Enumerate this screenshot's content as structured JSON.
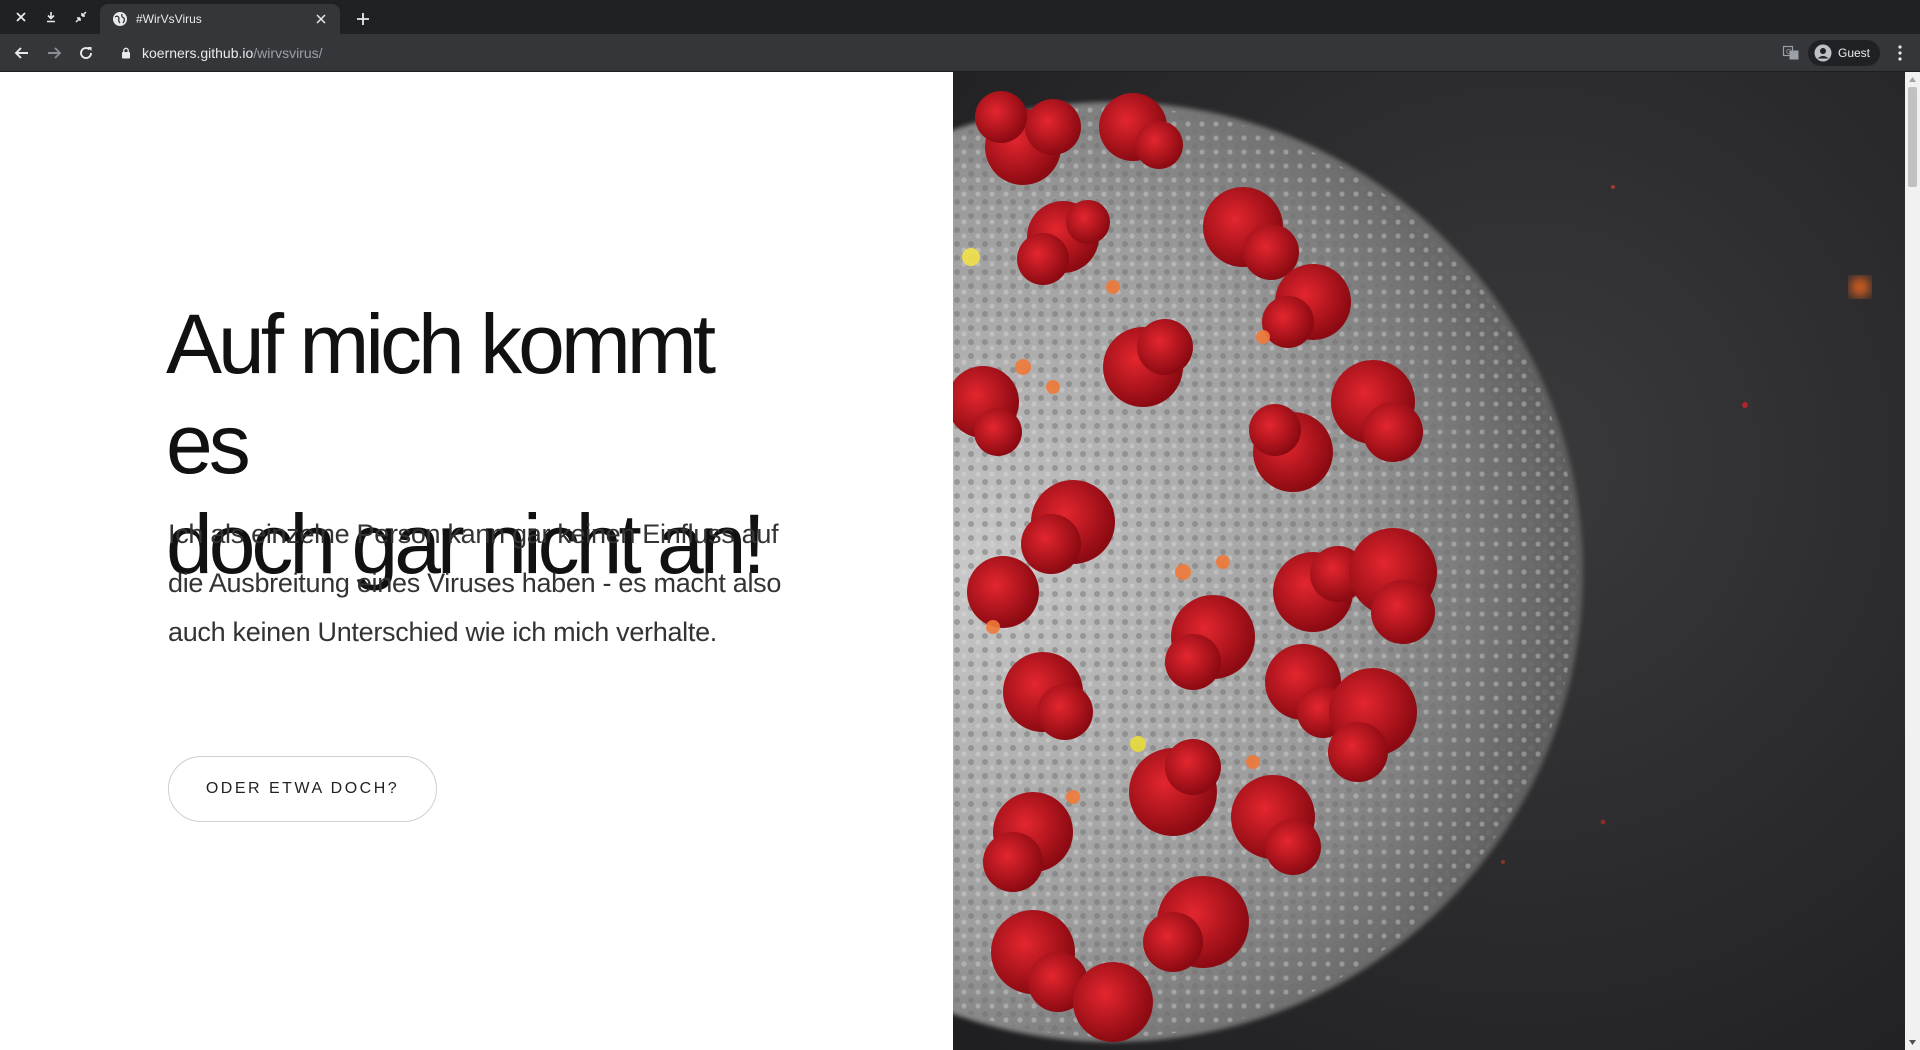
{
  "browser": {
    "tab_title": "#WirVsVirus",
    "url_host": "koerners.github.io",
    "url_path": "/wirvsvirus/",
    "profile_label": "Guest"
  },
  "page": {
    "headline_line1": "Auf mich kommt es",
    "headline_line2": "doch gar nicht an!",
    "subtext": "Ich als einzelne Person kann gar keinen Einfluss auf die Ausbreitung eines Viruses haben - es macht also auch keinen Unterschied wie ich mich verhalte.",
    "cta_label": "ODER ETWA DOCH?",
    "hero_image": "coronavirus-illustration"
  },
  "colors": {
    "chrome_dark": "#202124",
    "chrome_toolbar": "#35363a",
    "virus_spike": "#c0131f",
    "virus_body": "#9a9a9a",
    "backdrop": "#2c2c2e"
  }
}
